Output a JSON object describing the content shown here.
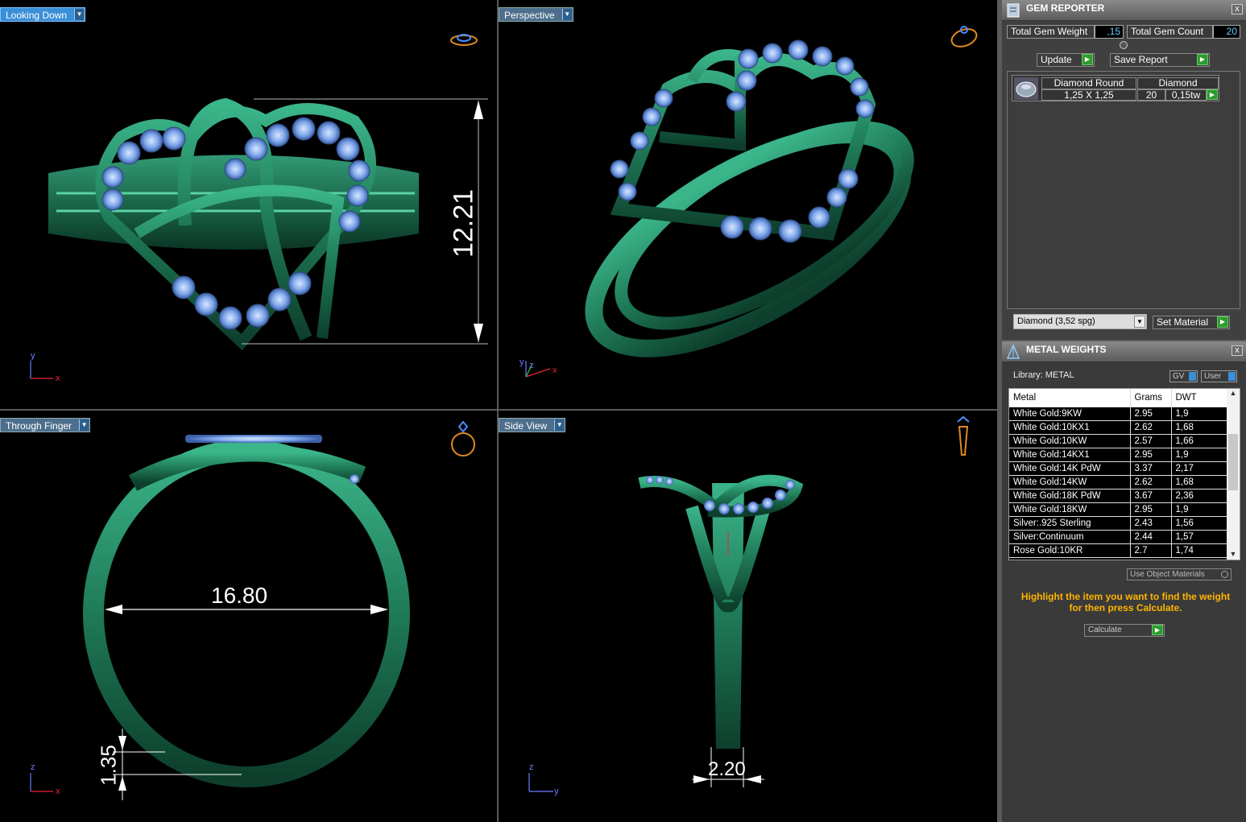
{
  "viewports": {
    "top_left": {
      "label": "Looking Down",
      "dim": "12.21",
      "axes": {
        "a": "y",
        "b": "x"
      }
    },
    "top_right": {
      "label": "Perspective",
      "axes": {
        "a": "z",
        "b": "x",
        "c": "y"
      }
    },
    "bottom_left": {
      "label": "Through Finger",
      "dim_main": "16.80",
      "dim_small": "1.35",
      "axes": {
        "a": "z",
        "b": "x"
      }
    },
    "bottom_right": {
      "label": "Side View",
      "dim": "2.20",
      "axes": {
        "a": "z",
        "b": "y"
      }
    }
  },
  "gem_reporter": {
    "title": "GEM REPORTER",
    "close": "x",
    "total_gem_weight_label": "Total Gem Weight",
    "total_gem_weight_value": ",15",
    "total_gem_count_label": "Total Gem Count",
    "total_gem_count_value": "20",
    "update_label": "Update",
    "save_report_label": "Save Report",
    "gem": {
      "shape": "Diamond Round",
      "size": "1,25 X 1,25",
      "material": "Diamond",
      "count": "20",
      "weight": "0,15tw"
    },
    "material_select": "Diamond     (3,52 spg)",
    "set_material_label": "Set Material"
  },
  "metal_weights": {
    "title": "METAL WEIGHTS",
    "close": "x",
    "library": "Library: METAL",
    "gv_label": "GV",
    "user_label": "User",
    "headers": [
      "Metal",
      "Grams",
      "DWT"
    ],
    "rows": [
      [
        "White Gold:9KW",
        "2.95",
        "1,9"
      ],
      [
        "White Gold:10KX1",
        "2.62",
        "1,68"
      ],
      [
        "White Gold:10KW",
        "2.57",
        "1,66"
      ],
      [
        "White Gold:14KX1",
        "2.95",
        "1,9"
      ],
      [
        "White Gold:14K PdW",
        "3.37",
        "2,17"
      ],
      [
        "White Gold:14KW",
        "2.62",
        "1,68"
      ],
      [
        "White Gold:18K PdW",
        "3.67",
        "2,36"
      ],
      [
        "White Gold:18KW",
        "2.95",
        "1,9"
      ],
      [
        "Silver:.925 Sterling",
        "2.43",
        "1,56"
      ],
      [
        "Silver:Continuum",
        "2.44",
        "1,57"
      ],
      [
        "Rose Gold:10KR",
        "2.7",
        "1,74"
      ]
    ],
    "use_object_materials": "Use Object Materials",
    "hint": "Highlight the item you want to find the weight for then press Calculate.",
    "calculate_label": "Calculate"
  },
  "colors": {
    "metal": "#1f7a57",
    "gem": "#7fa8ea",
    "label_active": "#3a8fd6",
    "hint": "#ffb400",
    "go_button": "#2e9b2e"
  }
}
